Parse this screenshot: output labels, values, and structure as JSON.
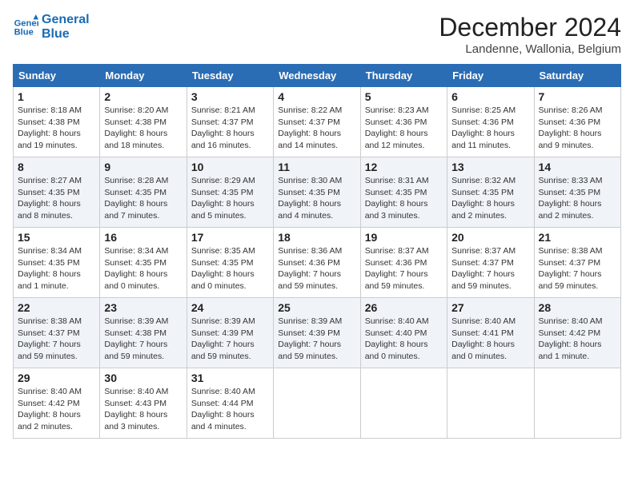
{
  "header": {
    "logo_line1": "General",
    "logo_line2": "Blue",
    "month": "December 2024",
    "location": "Landenne, Wallonia, Belgium"
  },
  "days_of_week": [
    "Sunday",
    "Monday",
    "Tuesday",
    "Wednesday",
    "Thursday",
    "Friday",
    "Saturday"
  ],
  "weeks": [
    [
      {
        "day": "1",
        "sunrise": "8:18 AM",
        "sunset": "4:38 PM",
        "daylight": "8 hours and 19 minutes."
      },
      {
        "day": "2",
        "sunrise": "8:20 AM",
        "sunset": "4:38 PM",
        "daylight": "8 hours and 18 minutes."
      },
      {
        "day": "3",
        "sunrise": "8:21 AM",
        "sunset": "4:37 PM",
        "daylight": "8 hours and 16 minutes."
      },
      {
        "day": "4",
        "sunrise": "8:22 AM",
        "sunset": "4:37 PM",
        "daylight": "8 hours and 14 minutes."
      },
      {
        "day": "5",
        "sunrise": "8:23 AM",
        "sunset": "4:36 PM",
        "daylight": "8 hours and 12 minutes."
      },
      {
        "day": "6",
        "sunrise": "8:25 AM",
        "sunset": "4:36 PM",
        "daylight": "8 hours and 11 minutes."
      },
      {
        "day": "7",
        "sunrise": "8:26 AM",
        "sunset": "4:36 PM",
        "daylight": "8 hours and 9 minutes."
      }
    ],
    [
      {
        "day": "8",
        "sunrise": "8:27 AM",
        "sunset": "4:35 PM",
        "daylight": "8 hours and 8 minutes."
      },
      {
        "day": "9",
        "sunrise": "8:28 AM",
        "sunset": "4:35 PM",
        "daylight": "8 hours and 7 minutes."
      },
      {
        "day": "10",
        "sunrise": "8:29 AM",
        "sunset": "4:35 PM",
        "daylight": "8 hours and 5 minutes."
      },
      {
        "day": "11",
        "sunrise": "8:30 AM",
        "sunset": "4:35 PM",
        "daylight": "8 hours and 4 minutes."
      },
      {
        "day": "12",
        "sunrise": "8:31 AM",
        "sunset": "4:35 PM",
        "daylight": "8 hours and 3 minutes."
      },
      {
        "day": "13",
        "sunrise": "8:32 AM",
        "sunset": "4:35 PM",
        "daylight": "8 hours and 2 minutes."
      },
      {
        "day": "14",
        "sunrise": "8:33 AM",
        "sunset": "4:35 PM",
        "daylight": "8 hours and 2 minutes."
      }
    ],
    [
      {
        "day": "15",
        "sunrise": "8:34 AM",
        "sunset": "4:35 PM",
        "daylight": "8 hours and 1 minute."
      },
      {
        "day": "16",
        "sunrise": "8:34 AM",
        "sunset": "4:35 PM",
        "daylight": "8 hours and 0 minutes."
      },
      {
        "day": "17",
        "sunrise": "8:35 AM",
        "sunset": "4:35 PM",
        "daylight": "8 hours and 0 minutes."
      },
      {
        "day": "18",
        "sunrise": "8:36 AM",
        "sunset": "4:36 PM",
        "daylight": "7 hours and 59 minutes."
      },
      {
        "day": "19",
        "sunrise": "8:37 AM",
        "sunset": "4:36 PM",
        "daylight": "7 hours and 59 minutes."
      },
      {
        "day": "20",
        "sunrise": "8:37 AM",
        "sunset": "4:37 PM",
        "daylight": "7 hours and 59 minutes."
      },
      {
        "day": "21",
        "sunrise": "8:38 AM",
        "sunset": "4:37 PM",
        "daylight": "7 hours and 59 minutes."
      }
    ],
    [
      {
        "day": "22",
        "sunrise": "8:38 AM",
        "sunset": "4:37 PM",
        "daylight": "7 hours and 59 minutes."
      },
      {
        "day": "23",
        "sunrise": "8:39 AM",
        "sunset": "4:38 PM",
        "daylight": "7 hours and 59 minutes."
      },
      {
        "day": "24",
        "sunrise": "8:39 AM",
        "sunset": "4:39 PM",
        "daylight": "7 hours and 59 minutes."
      },
      {
        "day": "25",
        "sunrise": "8:39 AM",
        "sunset": "4:39 PM",
        "daylight": "7 hours and 59 minutes."
      },
      {
        "day": "26",
        "sunrise": "8:40 AM",
        "sunset": "4:40 PM",
        "daylight": "8 hours and 0 minutes."
      },
      {
        "day": "27",
        "sunrise": "8:40 AM",
        "sunset": "4:41 PM",
        "daylight": "8 hours and 0 minutes."
      },
      {
        "day": "28",
        "sunrise": "8:40 AM",
        "sunset": "4:42 PM",
        "daylight": "8 hours and 1 minute."
      }
    ],
    [
      {
        "day": "29",
        "sunrise": "8:40 AM",
        "sunset": "4:42 PM",
        "daylight": "8 hours and 2 minutes."
      },
      {
        "day": "30",
        "sunrise": "8:40 AM",
        "sunset": "4:43 PM",
        "daylight": "8 hours and 3 minutes."
      },
      {
        "day": "31",
        "sunrise": "8:40 AM",
        "sunset": "4:44 PM",
        "daylight": "8 hours and 4 minutes."
      },
      null,
      null,
      null,
      null
    ]
  ]
}
